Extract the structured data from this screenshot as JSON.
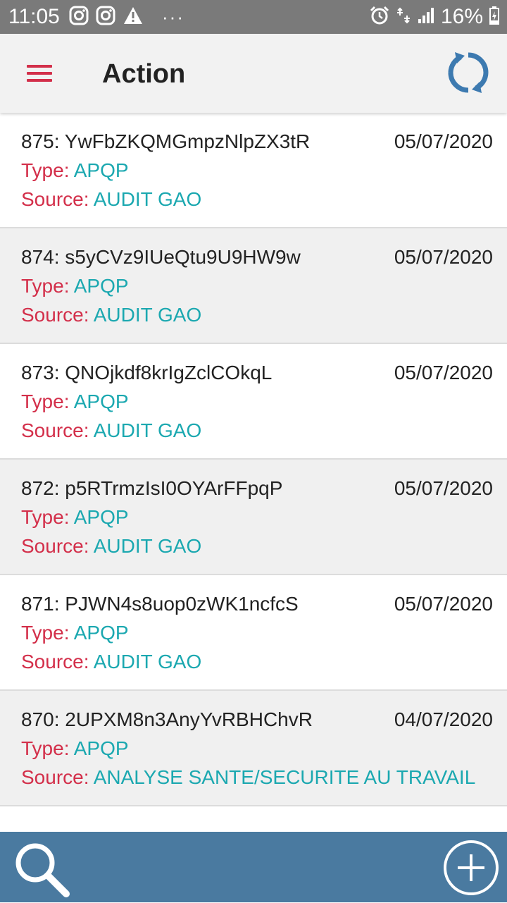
{
  "status_bar": {
    "time": "11:05",
    "left_icons": [
      "instagram-icon",
      "instagram-icon",
      "warning-icon",
      "more-dots-icon"
    ],
    "right_icons": [
      "alarm-icon",
      "data-arrows-icon",
      "signal-icon",
      "battery-charging-icon"
    ],
    "more_dots": "···",
    "battery_percent": "16%"
  },
  "app_bar": {
    "title": "Action",
    "menu_icon": "hamburger-menu-icon",
    "refresh_icon": "refresh-icon"
  },
  "labels": {
    "type": "Type:",
    "source": "Source:"
  },
  "actions": [
    {
      "title": "875: YwFbZKQMGmpzNlpZX3tR",
      "date": "05/07/2020",
      "type": "APQP",
      "source": "AUDIT GAO"
    },
    {
      "title": "874: s5yCVz9IUeQtu9U9HW9w",
      "date": "05/07/2020",
      "type": "APQP",
      "source": "AUDIT GAO"
    },
    {
      "title": "873: QNOjkdf8krIgZclCOkqL",
      "date": "05/07/2020",
      "type": "APQP",
      "source": "AUDIT GAO"
    },
    {
      "title": "872: p5RTrmzIsI0OYArFFpqP",
      "date": "05/07/2020",
      "type": "APQP",
      "source": "AUDIT GAO"
    },
    {
      "title": "871: PJWN4s8uop0zWK1ncfcS",
      "date": "05/07/2020",
      "type": "APQP",
      "source": "AUDIT GAO"
    },
    {
      "title": "870: 2UPXM8n3AnyYvRBHChvR",
      "date": "04/07/2020",
      "type": "APQP",
      "source": "ANALYSE SANTE/SECURITE AU TRAVAIL"
    },
    {
      "title": "",
      "date": "",
      "type": "",
      "source": ""
    }
  ],
  "bottom_bar": {
    "search_icon": "search-icon",
    "add_icon": "add-circle-icon"
  },
  "colors": {
    "status_bar": "#7a7a7a",
    "app_bar": "#f2f2f2",
    "accent_red": "#d32f4a",
    "value_teal": "#1ba8b0",
    "bottom_bar": "#4a7aa0",
    "refresh_blue": "#3d7ab0"
  }
}
